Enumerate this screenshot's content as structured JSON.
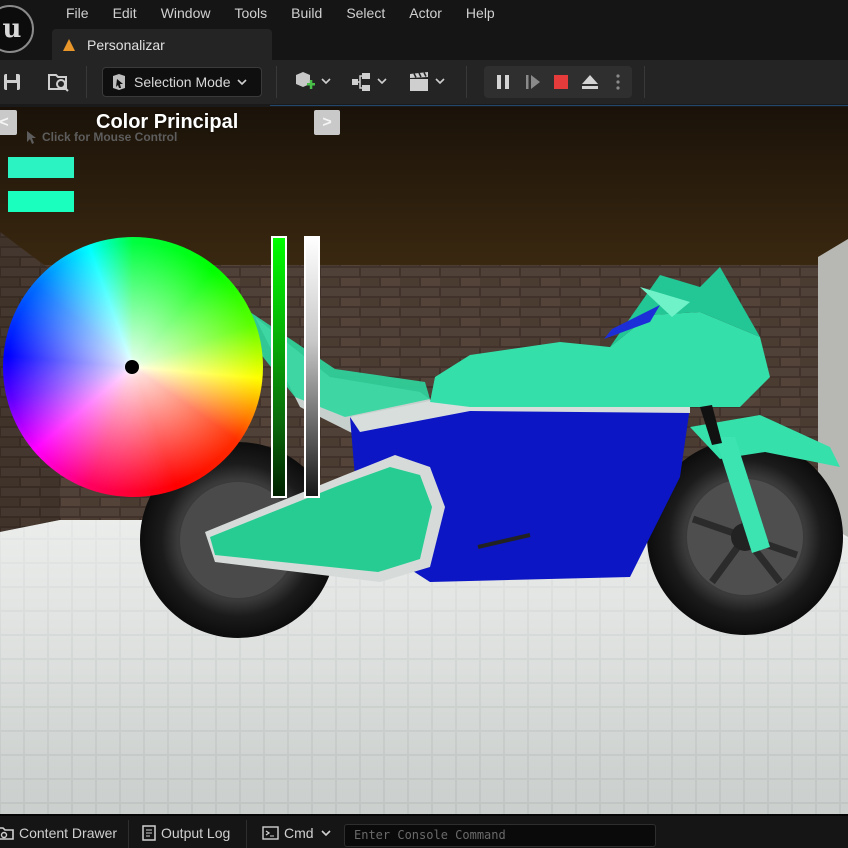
{
  "menu": {
    "items": [
      "File",
      "Edit",
      "Window",
      "Tools",
      "Build",
      "Select",
      "Actor",
      "Help"
    ]
  },
  "level_tab": {
    "label": "Personalizar",
    "icon": "level-warning-icon"
  },
  "toolbar": {
    "save_icon": "save-icon",
    "browse_icon": "content-browse-icon",
    "selection_mode_label": "Selection Mode",
    "add_actor_icon": "add-actor-icon",
    "blueprint_icon": "blueprint-icon",
    "cinematics_icon": "cinematics-icon",
    "pause_icon": "pause-icon",
    "advance_frame_icon": "advance-frame-icon",
    "stop_icon": "stop-icon",
    "eject_icon": "eject-icon",
    "more_icon": "more-options-icon"
  },
  "viewport": {
    "panel_title": "Color Principal",
    "prev_label": "<",
    "next_label": ">",
    "mouse_hint": "Click for Mouse Control",
    "current_color": "#2cf3c2",
    "preview_color": "#1affbe",
    "vehicle_body_color": "#2ee0a8",
    "vehicle_accent_color": "#0a18c8"
  },
  "statusbar": {
    "content_drawer": "Content Drawer",
    "output_log": "Output Log",
    "cmd_label": "Cmd",
    "console_placeholder": "Enter Console Command"
  }
}
